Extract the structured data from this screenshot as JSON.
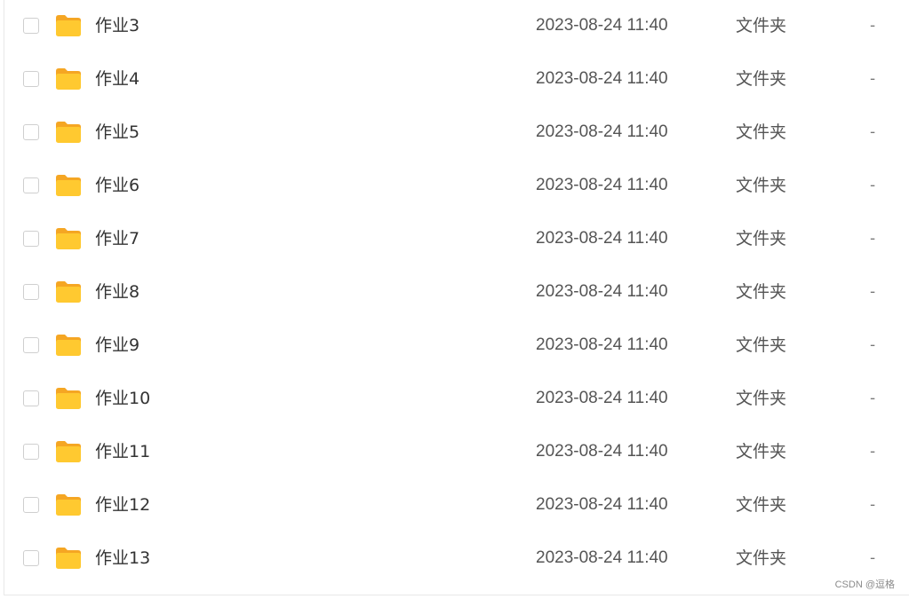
{
  "files": [
    {
      "name": "作业3",
      "date": "2023-08-24 11:40",
      "type": "文件夹",
      "size": "-",
      "icon": "folder-icon"
    },
    {
      "name": "作业4",
      "date": "2023-08-24 11:40",
      "type": "文件夹",
      "size": "-",
      "icon": "folder-icon"
    },
    {
      "name": "作业5",
      "date": "2023-08-24 11:40",
      "type": "文件夹",
      "size": "-",
      "icon": "folder-icon"
    },
    {
      "name": "作业6",
      "date": "2023-08-24 11:40",
      "type": "文件夹",
      "size": "-",
      "icon": "folder-icon"
    },
    {
      "name": "作业7",
      "date": "2023-08-24 11:40",
      "type": "文件夹",
      "size": "-",
      "icon": "folder-icon"
    },
    {
      "name": "作业8",
      "date": "2023-08-24 11:40",
      "type": "文件夹",
      "size": "-",
      "icon": "folder-icon"
    },
    {
      "name": "作业9",
      "date": "2023-08-24 11:40",
      "type": "文件夹",
      "size": "-",
      "icon": "folder-icon"
    },
    {
      "name": "作业10",
      "date": "2023-08-24 11:40",
      "type": "文件夹",
      "size": "-",
      "icon": "folder-icon"
    },
    {
      "name": "作业11",
      "date": "2023-08-24 11:40",
      "type": "文件夹",
      "size": "-",
      "icon": "folder-icon"
    },
    {
      "name": "作业12",
      "date": "2023-08-24 11:40",
      "type": "文件夹",
      "size": "-",
      "icon": "folder-icon"
    },
    {
      "name": "作业13",
      "date": "2023-08-24 11:40",
      "type": "文件夹",
      "size": "-",
      "icon": "folder-icon"
    }
  ],
  "watermark": "CSDN @逗格",
  "colors": {
    "folder_body": "#FFC930",
    "folder_back": "#F5A623",
    "text_primary": "#333333",
    "text_secondary": "#555555",
    "checkbox_border": "#cfcfcf"
  }
}
